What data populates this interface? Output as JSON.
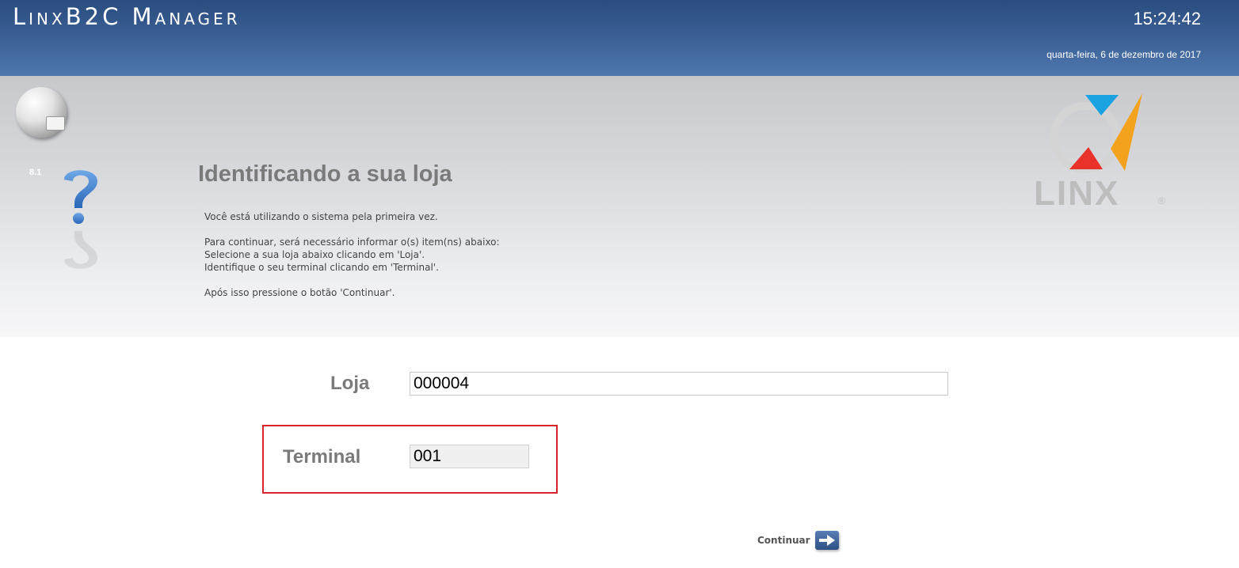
{
  "header": {
    "app_title": "LinxB2C Manager",
    "clock": "15:24:42",
    "date": "quarta-feira, 6 de dezembro de 2017"
  },
  "sidebar": {
    "version": "8.1",
    "globe_icon": "globe-icon",
    "help_icon": "question-mark-icon"
  },
  "page": {
    "title": "Identificando a sua loja",
    "instructions": [
      "Você está utilizando o sistema pela primeira vez.",
      "",
      "Para continuar, será necessário informar o(s) item(ns) abaixo:",
      "Selecione a sua loja abaixo clicando em 'Loja'.",
      "Identifique o seu terminal clicando em 'Terminal'.",
      "",
      "Após isso pressione o botão 'Continuar'."
    ]
  },
  "logo": {
    "text": "LINX",
    "reg": "®",
    "colors": {
      "blue": "#1aa3e0",
      "orange": "#f2a21c",
      "red": "#e8322a",
      "grey": "#bdbdbd"
    }
  },
  "form": {
    "loja": {
      "label": "Loja",
      "value": "000004"
    },
    "terminal": {
      "label": "Terminal",
      "value": "001"
    },
    "continue_label": "Continuar",
    "continue_icon": "arrow-right-icon",
    "highlight_color": "#d9232d"
  }
}
